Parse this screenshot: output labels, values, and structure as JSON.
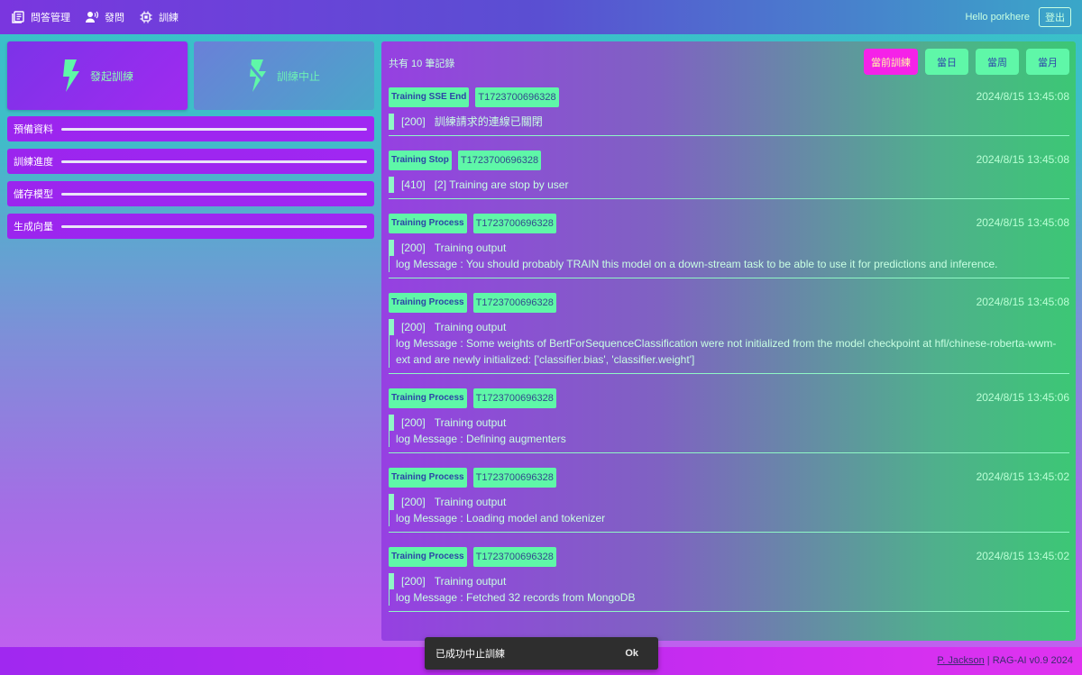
{
  "nav": {
    "qa_manage": "問答管理",
    "ask": "發問",
    "train": "訓練"
  },
  "user": {
    "greeting": "Hello porkhere",
    "logout": "登出"
  },
  "actions": {
    "start": "發起訓練",
    "stop": "訓練中止"
  },
  "steps": [
    "預備資料",
    "訓練進度",
    "儲存模型",
    "生成向量"
  ],
  "records": {
    "count": "共有 10 筆記錄",
    "filters": [
      "當前訓練",
      "當日",
      "當周",
      "當月"
    ],
    "items": [
      {
        "type": "Training SSE End",
        "id": "T1723700696328",
        "time": "2024/8/15 13:45:08",
        "code": "[200]",
        "title": "訓練請求的連線已關閉",
        "message": ""
      },
      {
        "type": "Training Stop",
        "id": "T1723700696328",
        "time": "2024/8/15 13:45:08",
        "code": "[410]",
        "title": "[2] Training are stop by user",
        "message": ""
      },
      {
        "type": "Training Process",
        "id": "T1723700696328",
        "time": "2024/8/15 13:45:08",
        "code": "[200]",
        "title": "Training output",
        "message": "log Message : You should probably TRAIN this model on a down-stream task to be able to use it for predictions and inference."
      },
      {
        "type": "Training Process",
        "id": "T1723700696328",
        "time": "2024/8/15 13:45:08",
        "code": "[200]",
        "title": "Training output",
        "message": "log Message : Some weights of BertForSequenceClassification were not initialized from the model checkpoint at hfl/chinese-roberta-wwm-ext and are newly initialized: ['classifier.bias', 'classifier.weight']"
      },
      {
        "type": "Training Process",
        "id": "T1723700696328",
        "time": "2024/8/15 13:45:06",
        "code": "[200]",
        "title": "Training output",
        "message": "log Message : Defining augmenters"
      },
      {
        "type": "Training Process",
        "id": "T1723700696328",
        "time": "2024/8/15 13:45:02",
        "code": "[200]",
        "title": "Training output",
        "message": "log Message : Loading model and tokenizer"
      },
      {
        "type": "Training Process",
        "id": "T1723700696328",
        "time": "2024/8/15 13:45:02",
        "code": "[200]",
        "title": "Training output",
        "message": "log Message : Fetched 32 records from MongoDB"
      }
    ]
  },
  "footer": {
    "author": "P. Jackson",
    "version": " | RAG-AI v0.9 2024"
  },
  "toast": {
    "message": "已成功中止訓練",
    "ok": "Ok"
  }
}
